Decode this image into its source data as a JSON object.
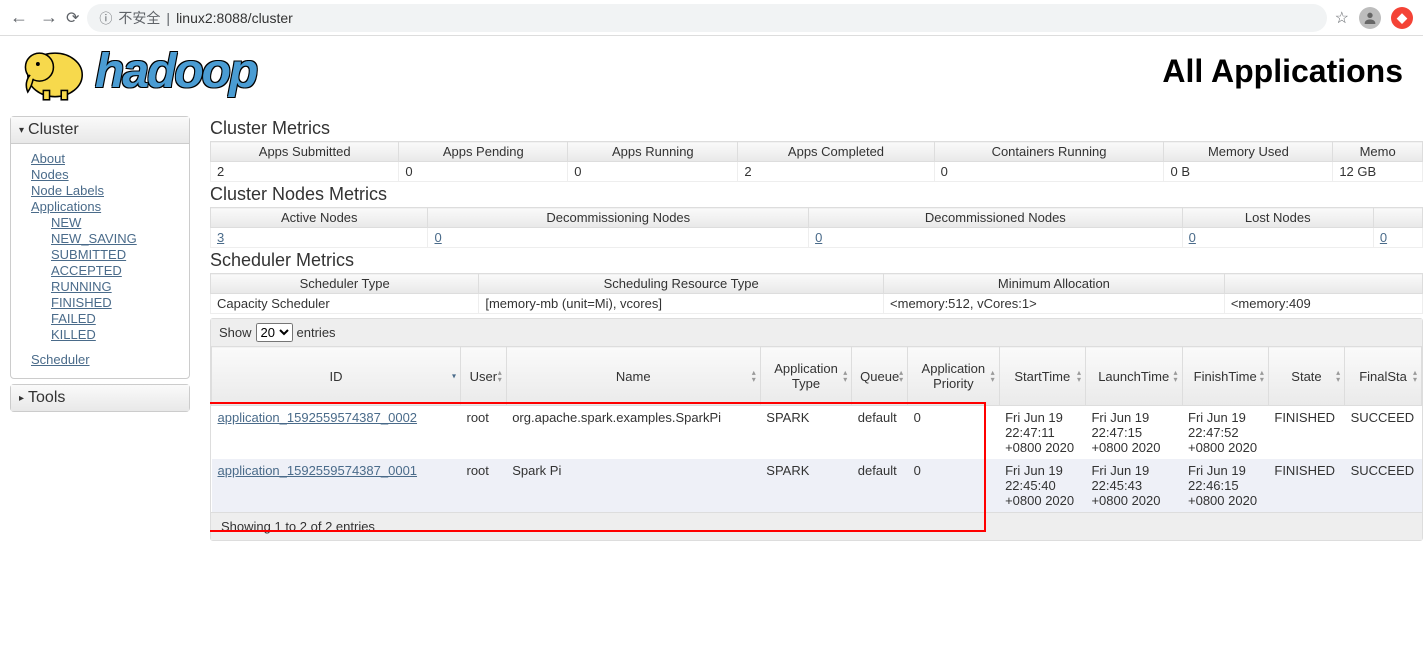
{
  "browser": {
    "insecure_label": "不安全",
    "url": "linux2:8088/cluster"
  },
  "header": {
    "logo_text": "hadoop",
    "page_title": "All Applications"
  },
  "sidebar": {
    "cluster_title": "Cluster",
    "tools_title": "Tools",
    "links": {
      "about": "About",
      "nodes": "Nodes",
      "node_labels": "Node Labels",
      "applications": "Applications",
      "new": "NEW",
      "new_saving": "NEW_SAVING",
      "submitted": "SUBMITTED",
      "accepted": "ACCEPTED",
      "running": "RUNNING",
      "finished": "FINISHED",
      "failed": "FAILED",
      "killed": "KILLED",
      "scheduler": "Scheduler"
    }
  },
  "sections": {
    "cluster_metrics": "Cluster Metrics",
    "cluster_nodes_metrics": "Cluster Nodes Metrics",
    "scheduler_metrics": "Scheduler Metrics"
  },
  "cluster_metrics": {
    "headers": [
      "Apps Submitted",
      "Apps Pending",
      "Apps Running",
      "Apps Completed",
      "Containers Running",
      "Memory Used",
      "Memo"
    ],
    "values": [
      "2",
      "0",
      "0",
      "2",
      "0",
      "0 B",
      "12 GB"
    ]
  },
  "nodes_metrics": {
    "headers": [
      "Active Nodes",
      "Decommissioning Nodes",
      "Decommissioned Nodes",
      "Lost Nodes",
      ""
    ],
    "values": [
      "3",
      "0",
      "0",
      "0",
      "0"
    ]
  },
  "scheduler_metrics": {
    "headers": [
      "Scheduler Type",
      "Scheduling Resource Type",
      "Minimum Allocation",
      ""
    ],
    "values": [
      "Capacity Scheduler",
      "[memory-mb (unit=Mi), vcores]",
      "<memory:512, vCores:1>",
      "<memory:409"
    ]
  },
  "datatable": {
    "show_label": "Show",
    "entries_label": "entries",
    "page_size": "20",
    "columns": [
      "ID",
      "User",
      "Name",
      "Application Type",
      "Queue",
      "Application Priority",
      "StartTime",
      "LaunchTime",
      "FinishTime",
      "State",
      "FinalSta"
    ],
    "rows": [
      {
        "id": "application_1592559574387_0002",
        "user": "root",
        "name": "org.apache.spark.examples.SparkPi",
        "type": "SPARK",
        "queue": "default",
        "priority": "0",
        "start": "Fri Jun 19 22:47:11 +0800 2020",
        "launch": "Fri Jun 19 22:47:15 +0800 2020",
        "finish": "Fri Jun 19 22:47:52 +0800 2020",
        "state": "FINISHED",
        "final": "SUCCEED"
      },
      {
        "id": "application_1592559574387_0001",
        "user": "root",
        "name": "Spark Pi",
        "type": "SPARK",
        "queue": "default",
        "priority": "0",
        "start": "Fri Jun 19 22:45:40 +0800 2020",
        "launch": "Fri Jun 19 22:45:43 +0800 2020",
        "finish": "Fri Jun 19 22:46:15 +0800 2020",
        "state": "FINISHED",
        "final": "SUCCEED"
      }
    ],
    "footer": "Showing 1 to 2 of 2 entries"
  }
}
